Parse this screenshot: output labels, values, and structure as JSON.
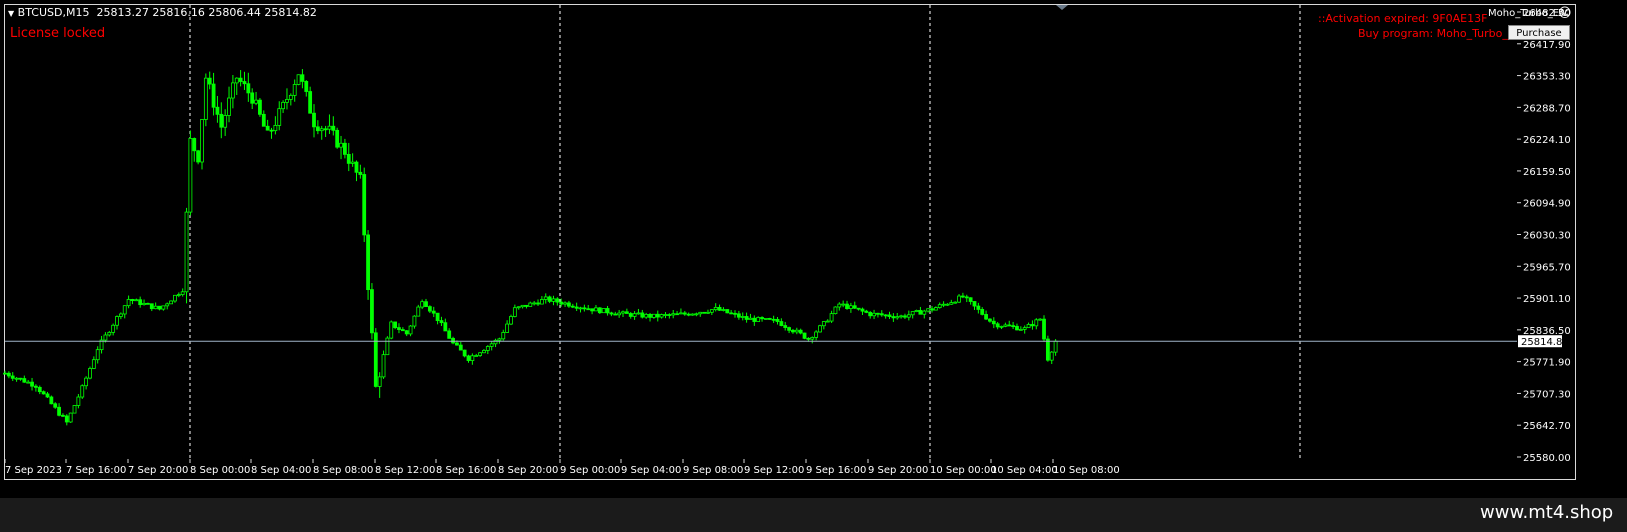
{
  "header": {
    "symbol": "BTCUSD,M15",
    "ohlc": "25813.27 25816.16 25806.44 25814.82"
  },
  "overlay": {
    "license_text": "License locked",
    "activation_text": "::Activation expired: 9F0AE13F",
    "buy_text": "Buy program: Moho_Turbo_EA",
    "purchase_label": "Purchase",
    "ea_name": "Moho_Turbo_EA",
    "ea_icon": "smiley-icon"
  },
  "price_axis": {
    "labels": [
      "26482.50",
      "26417.90",
      "26353.30",
      "26288.70",
      "26224.10",
      "26159.50",
      "26094.90",
      "26030.30",
      "25965.70",
      "25901.10",
      "25836.50",
      "25771.90",
      "25707.30",
      "25642.70",
      "25580.00"
    ],
    "current_price": "25814.82"
  },
  "time_axis": {
    "labels": [
      "7 Sep 2023",
      "7 Sep 16:00",
      "7 Sep 20:00",
      "8 Sep 00:00",
      "8 Sep 04:00",
      "8 Sep 08:00",
      "8 Sep 12:00",
      "8 Sep 16:00",
      "8 Sep 20:00",
      "9 Sep 00:00",
      "9 Sep 04:00",
      "9 Sep 08:00",
      "9 Sep 12:00",
      "9 Sep 16:00",
      "9 Sep 20:00",
      "10 Sep 00:00",
      "10 Sep 04:00",
      "10 Sep 08:00"
    ]
  },
  "chart_data": {
    "type": "candlestick",
    "symbol": "BTCUSD",
    "timeframe": "M15",
    "ylim": [
      25580.0,
      26482.5
    ],
    "current_price": 25814.82,
    "colors": {
      "candle": "#00ff00",
      "background": "#000000",
      "grid_separator": "#ffffff",
      "bid_line": "#a0b4c8"
    },
    "close_path": [
      [
        "7 Sep 12:00",
        25750
      ],
      [
        "7 Sep 14:00",
        25725
      ],
      [
        "7 Sep 16:00",
        25650
      ],
      [
        "7 Sep 17:00",
        25720
      ],
      [
        "7 Sep 18:00",
        25800
      ],
      [
        "7 Sep 20:00",
        25900
      ],
      [
        "7 Sep 22:00",
        25880
      ],
      [
        "7 Sep 23:30",
        25920
      ],
      [
        "8 Sep 00:00",
        26220
      ],
      [
        "8 Sep 00:30",
        26190
      ],
      [
        "8 Sep 01:00",
        26350
      ],
      [
        "8 Sep 02:00",
        26250
      ],
      [
        "8 Sep 03:00",
        26350
      ],
      [
        "8 Sep 04:00",
        26310
      ],
      [
        "8 Sep 05:00",
        26230
      ],
      [
        "8 Sep 06:00",
        26290
      ],
      [
        "8 Sep 07:00",
        26360
      ],
      [
        "8 Sep 08:00",
        26260
      ],
      [
        "8 Sep 09:00",
        26240
      ],
      [
        "8 Sep 10:00",
        26200
      ],
      [
        "8 Sep 11:00",
        26140
      ],
      [
        "8 Sep 12:00",
        25720
      ],
      [
        "8 Sep 13:00",
        25850
      ],
      [
        "8 Sep 14:00",
        25830
      ],
      [
        "8 Sep 15:00",
        25900
      ],
      [
        "8 Sep 16:00",
        25860
      ],
      [
        "8 Sep 17:00",
        25810
      ],
      [
        "8 Sep 18:00",
        25780
      ],
      [
        "8 Sep 19:00",
        25800
      ],
      [
        "8 Sep 20:00",
        25820
      ],
      [
        "8 Sep 21:00",
        25880
      ],
      [
        "8 Sep 22:00",
        25890
      ],
      [
        "8 Sep 23:00",
        25900
      ],
      [
        "9 Sep 02:00",
        25880
      ],
      [
        "9 Sep 04:00",
        25870
      ],
      [
        "9 Sep 06:00",
        25865
      ],
      [
        "9 Sep 08:00",
        25870
      ],
      [
        "9 Sep 10:00",
        25880
      ],
      [
        "9 Sep 12:00",
        25860
      ],
      [
        "9 Sep 14:00",
        25855
      ],
      [
        "9 Sep 16:00",
        25820
      ],
      [
        "9 Sep 17:00",
        25850
      ],
      [
        "9 Sep 18:00",
        25890
      ],
      [
        "9 Sep 20:00",
        25870
      ],
      [
        "9 Sep 22:00",
        25865
      ],
      [
        "10 Sep 00:00",
        25880
      ],
      [
        "10 Sep 02:00",
        25905
      ],
      [
        "10 Sep 04:00",
        25850
      ],
      [
        "10 Sep 06:00",
        25840
      ],
      [
        "10 Sep 07:00",
        25860
      ],
      [
        "10 Sep 07:30",
        25780
      ],
      [
        "10 Sep 08:00",
        25815
      ]
    ]
  },
  "footer": {
    "watermark": "www.mt4.shop"
  }
}
